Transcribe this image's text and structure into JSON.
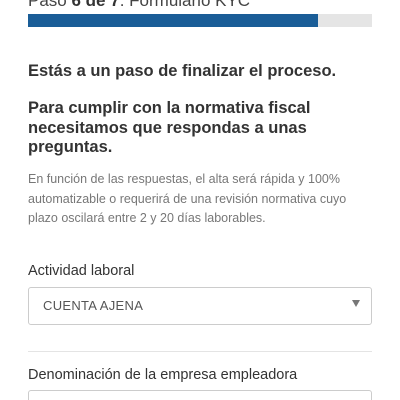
{
  "header": {
    "step_prefix": "Paso ",
    "step_current": "6",
    "step_separator": " de ",
    "step_total": "7",
    "step_suffix": ". Formulario KYC",
    "progress_fraction": 0.842,
    "progress_color": "#1a5d97"
  },
  "intro": {
    "lead": "Estás a un paso de finalizar el proceso.",
    "question": "Para cumplir con la normativa fiscal necesitamos que respondas a unas preguntas.",
    "info": "En función de las respuestas, el alta será rápida y 100% automatizable o requerirá de una revisión normativa cuyo plazo oscilará entre 2 y 20 días laborables."
  },
  "form": {
    "activity_label": "Actividad laboral",
    "activity_value": "CUENTA AJENA",
    "activity_caret_icon": "caret-down-icon",
    "company_label": "Denominación de la empresa empleadora",
    "company_value": ""
  }
}
